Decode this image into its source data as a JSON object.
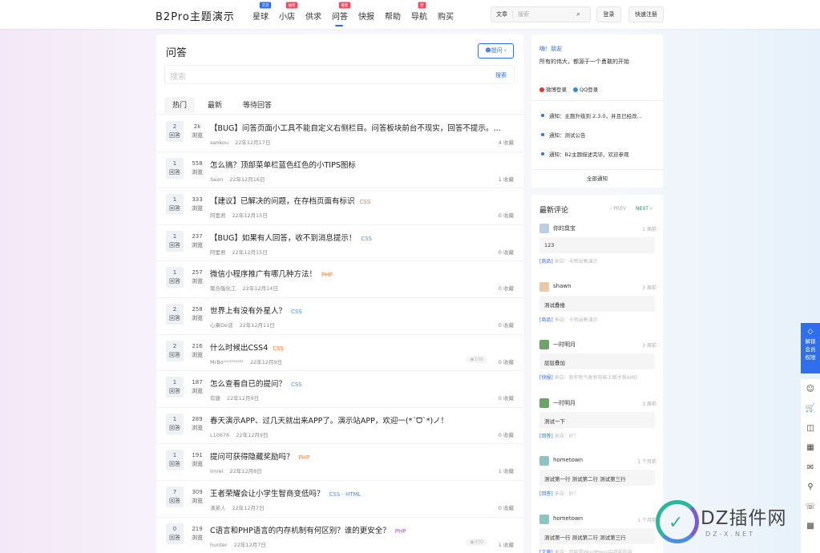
{
  "header": {
    "logo": "B2Pro主题演示",
    "nav": [
      {
        "label": "星球",
        "badge": "交流",
        "badge_color": "#2f6fed"
      },
      {
        "label": "小店",
        "badge": "抽奖",
        "badge_color": "#f04a63"
      },
      {
        "label": "供求",
        "badge": "",
        "badge_color": ""
      },
      {
        "label": "问答",
        "badge": "最新",
        "badge_color": "#f04a63",
        "active": true
      },
      {
        "label": "快报",
        "badge": "",
        "badge_color": ""
      },
      {
        "label": "帮助",
        "badge": "",
        "badge_color": ""
      },
      {
        "label": "导航",
        "badge": "新",
        "badge_color": "#f04a63"
      },
      {
        "label": "购买",
        "badge": "",
        "badge_color": ""
      }
    ],
    "search_type": "文章",
    "search_placeholder": "搜索",
    "login": "登录",
    "register": "快速注册"
  },
  "main": {
    "title": "问答",
    "ask_button": "提问",
    "search_placeholder": "搜索",
    "search_button": "搜索",
    "tabs": [
      "热门",
      "最新",
      "等待回答"
    ],
    "answers_label": "回答",
    "views_label": "浏览",
    "fav_suffix": "收藏",
    "questions": [
      {
        "answers": "2",
        "views": "2k",
        "title": "【BUG】问答页面小工具不能自定义右侧栏目。问答板块前台不现实，回答不提示。所有的提问和回答只能在后台找到！",
        "tag": "",
        "author": "sankou",
        "date": "22年12月17日",
        "reward": "",
        "favs": "4 收藏"
      },
      {
        "answers": "1",
        "views": "558",
        "title": "怎么搞？顶部菜单栏蓝色红色的小TIPS图标",
        "tag": "",
        "author": "Sean",
        "date": "22年12月16日",
        "reward": "",
        "favs": "1 收藏"
      },
      {
        "answers": "1",
        "views": "333",
        "title": "【建议】已解决的问题，在存档页面有标识",
        "tag": "CSS",
        "tag_class": "t-php",
        "author": "阿里君",
        "date": "22年12月15日",
        "reward": "",
        "favs": "0 收藏"
      },
      {
        "answers": "1",
        "views": "237",
        "title": "【BUG】如果有人回答，收不到消息提示！",
        "tag": "CSS",
        "tag_class": "t-css",
        "author": "阿里君",
        "date": "22年12月15日",
        "reward": "",
        "favs": "0 收藏"
      },
      {
        "answers": "1",
        "views": "257",
        "title": "微信小程序推广有哪几种方法！",
        "tag": "PHP",
        "tag_class": "t-php",
        "author": "聚合脂化工",
        "date": "22年12月14日",
        "reward": "",
        "favs": "0 收藏"
      },
      {
        "answers": "2",
        "views": "258",
        "title": "世界上有没有外星人？",
        "tag": "CSS",
        "tag_class": "t-css",
        "author": "心果De话",
        "date": "22年12月11日",
        "reward": "",
        "favs": "0 收藏"
      },
      {
        "answers": "2",
        "views": "216",
        "title": "什么时候出CSS4",
        "tag": "CSS",
        "tag_class": "t-php",
        "author": "MrBoᴸᴼᵛᴱᴾᴴᴼᴺᴱ",
        "date": "22年12月9日",
        "reward": "100",
        "favs": "0 收藏"
      },
      {
        "answers": "1",
        "views": "187",
        "title": "怎么查看自已的提问？",
        "tag": "CSS",
        "tag_class": "t-css",
        "author": "有唐",
        "date": "22年12月9日",
        "reward": "",
        "favs": "0 收藏"
      },
      {
        "answers": "1",
        "views": "289",
        "title": "春天演示APP、过几天就出来APP了。演示站APP，欢迎一(*ˊᗜˋ*)ノ！",
        "tag": "",
        "author": "L10676",
        "date": "22年12月9日",
        "reward": "",
        "favs": "0 收藏"
      },
      {
        "answers": "1",
        "views": "191",
        "title": "提问可获得隐藏奖励吗？",
        "tag": "PHP",
        "tag_class": "t-php",
        "author": "imrei",
        "date": "22年12月8日",
        "reward": "",
        "favs": "1 收藏"
      },
      {
        "answers": "7",
        "views": "309",
        "title": "王者荣耀会让小学生智商变低吗？",
        "tag": "CSS · HTML",
        "tag_class": "t-css",
        "author": "滴某人",
        "date": "22年12月7日",
        "reward": "",
        "favs": "0 收藏"
      },
      {
        "answers": "0",
        "views": "219",
        "title": "C语言和PHP语言的内存机制有何区别？谁的更安全？",
        "tag": "PHP",
        "tag_class": "t-php2",
        "author": "hunter",
        "date": "22年12月7日",
        "reward": "300",
        "favs": "1 收藏"
      }
    ]
  },
  "sidebar_user": {
    "hello": "嗨！朋友",
    "slogan": "所有的伟大，都源于一个勇敢的开始",
    "weibo": "微博登录",
    "qq": "QQ登录",
    "notices": [
      "通知：主题升级到 2.3.0，并且已经改…",
      "通知：测试公告",
      "通知：B2主题描述完毕，欢迎参观"
    ],
    "all_notices": "全部通知"
  },
  "sidebar_comments": {
    "title": "最新评论",
    "prev": "PREV",
    "next": "NEXT",
    "items": [
      {
        "name": "你的臭宝",
        "time": "1 周前",
        "body": "123",
        "from_tag": "[商品]",
        "from_text": "来自：卡密出售演示"
      },
      {
        "name": "shawn",
        "time": "3 周前",
        "body": "测试叠楼",
        "from_tag": "[商品]",
        "from_text": "来自：卡密出售演示"
      },
      {
        "name": "一时明月",
        "time": "3 周前",
        "body": "层层叠加",
        "from_tag": "[快报]",
        "from_text": "来自：新年新气象新电脑上图才爽AMD"
      },
      {
        "name": "一时明月",
        "time": "3 周前",
        "body": "测试一下",
        "from_tag": "[回答]",
        "from_text": "来自：好！"
      },
      {
        "name": "hometown",
        "time": "1 个月前",
        "body": "测试第一行 测试第二行 测试第三行",
        "from_tag": "[回答]",
        "from_text": "来自：好！"
      },
      {
        "name": "hometown",
        "time": "1 个月前",
        "body": "测试第一行 测试第二行 测试第三行",
        "from_tag": "[文章]",
        "from_text": "来自：可能是WordPress中目前的自…"
      }
    ]
  },
  "floating": {
    "vip": [
      "解锁",
      "会员",
      "权限"
    ],
    "tools": [
      "user-icon",
      "cart-icon",
      "compare-icon",
      "gift-icon",
      "mail-icon",
      "search-icon",
      "headset-icon",
      "qr-icon"
    ]
  },
  "watermark": {
    "text": "DZ插件网",
    "sub": "DZ-X.NET"
  }
}
